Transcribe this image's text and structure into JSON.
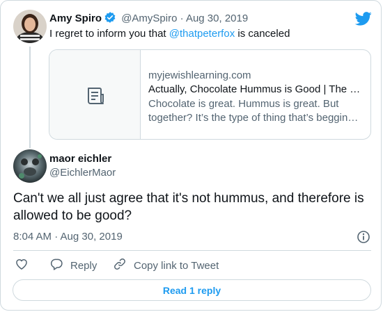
{
  "parent_tweet": {
    "name": "Amy Spiro",
    "handle": "@AmySpiro",
    "separator": "·",
    "date": "Aug 30, 2019",
    "text_before": "I regret to inform you that ",
    "mention": "@thatpeterfox",
    "text_after": " is canceled"
  },
  "link_card": {
    "domain": "myjewishlearning.com",
    "title": "Actually, Chocolate Hummus is Good | The …",
    "description_line1": "Chocolate is great. Hummus is great. But",
    "description_line2": "together? It’s the type of thing that’s beggin…"
  },
  "main_tweet": {
    "name": "maor eichler",
    "handle": "@EichlerMaor",
    "text": "Can't we all just agree that it's not hummus, and therefore is allowed to be good?",
    "timestamp": "8:04 AM · Aug 30, 2019"
  },
  "actions": {
    "reply_label": "Reply",
    "copy_link_label": "Copy link to Tweet"
  },
  "read_replies_label": "Read 1 reply",
  "icons": {
    "brand": "twitter-bird-icon",
    "verified": "verified-badge-icon",
    "link_placeholder": "document-icon",
    "info": "info-icon",
    "like": "heart-icon",
    "reply": "speech-bubble-icon",
    "copy_link": "link-icon"
  },
  "colors": {
    "accent": "#1d9bf0",
    "text_primary": "#0f1419",
    "text_secondary": "#536471",
    "border": "#cfd9de"
  }
}
